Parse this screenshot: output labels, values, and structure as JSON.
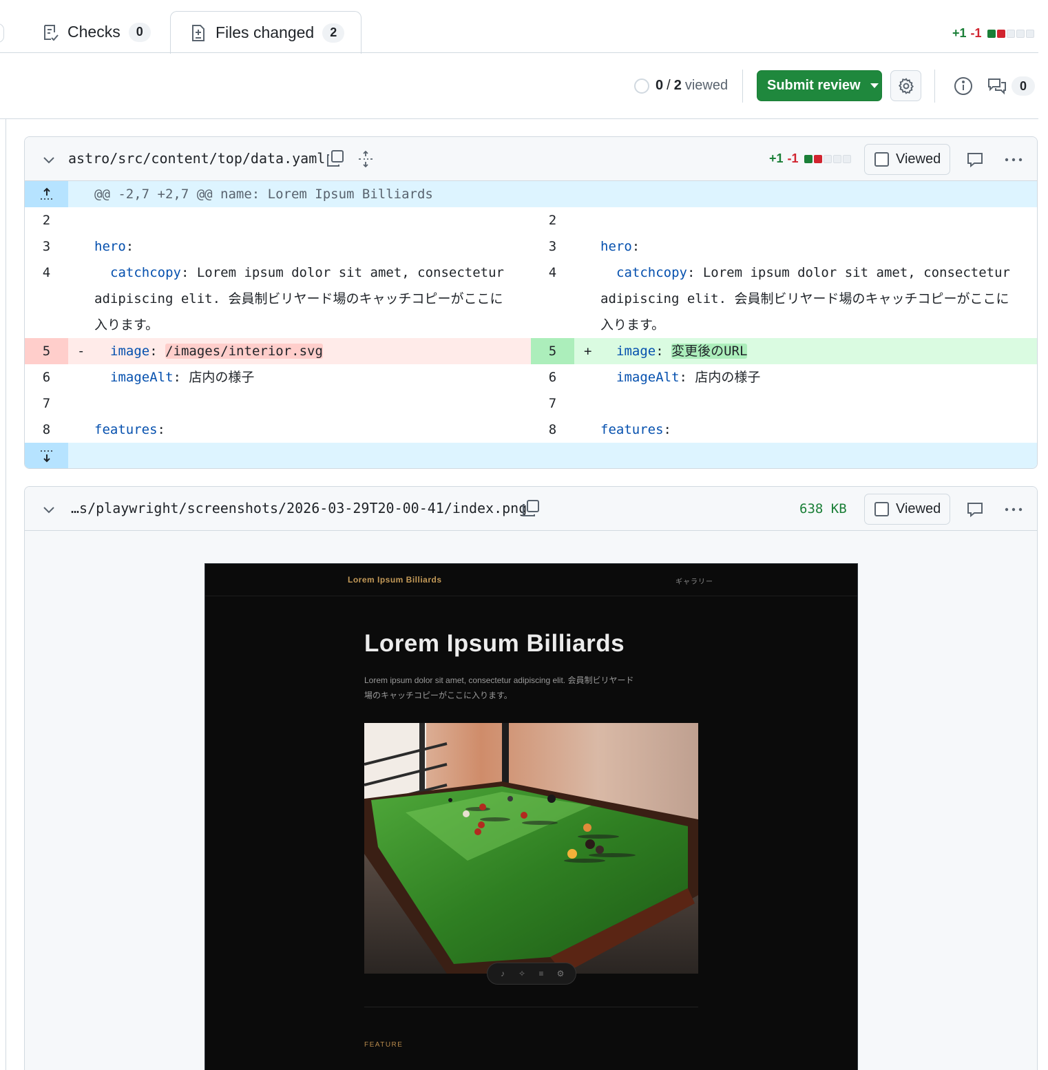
{
  "tabs": {
    "checks": {
      "label": "Checks",
      "count": "0"
    },
    "files_changed": {
      "label": "Files changed",
      "count": "2"
    },
    "diffstat": {
      "additions": "+1",
      "deletions": "-1"
    }
  },
  "toolbar": {
    "viewed_count": "0",
    "viewed_separator": "/",
    "viewed_total": "2",
    "viewed_label": "viewed",
    "submit_label": "Submit review",
    "comments_count": "0"
  },
  "file1": {
    "path": "astro/src/content/top/data.yaml",
    "additions": "+1",
    "deletions": "-1",
    "viewed_label": "Viewed",
    "hunk_header": "@@ -2,7 +2,7 @@ name: Lorem Ipsum Billiards",
    "lines": {
      "l2": "2",
      "l3": "3",
      "l4": "4",
      "l5": "5",
      "l6": "6",
      "l7": "7",
      "l8": "8"
    },
    "code": {
      "hero_key": "hero",
      "catchcopy_key": "catchcopy",
      "catchcopy_line1": " Lorem ipsum dolor sit amet, consectetur",
      "catchcopy_line2": "adipiscing elit. 会員制ビリヤード場のキャッチコピーがここに",
      "catchcopy_line3": "入ります。",
      "image_key": "image",
      "image_old": "/images/interior.svg",
      "image_new": "変更後のURL",
      "imagealt_key": "imageAlt",
      "imagealt_value": " 店内の様子",
      "features_key": "features",
      "colon": ":",
      "minus": "-",
      "plus": "+"
    }
  },
  "file2": {
    "path": "…s/playwright/screenshots/2026-03-29T20-00-41/index.png",
    "size": "638 KB",
    "viewed_label": "Viewed",
    "preview": {
      "brand": "Lorem Ipsum Billiards",
      "nav_link": "ギャラリー",
      "title": "Lorem Ipsum Billiards",
      "subtitle_line1": "Lorem ipsum dolor sit amet, consectetur adipiscing elit. 会員制ビリヤード",
      "subtitle_line2": "場のキャッチコピーがここに入ります。",
      "section_label": "FEATURE"
    }
  },
  "colors": {
    "addition": "#1a7f37",
    "deletion": "#d1242f",
    "primary_button": "#1f883d",
    "hunk_bg": "#ddf4ff"
  }
}
